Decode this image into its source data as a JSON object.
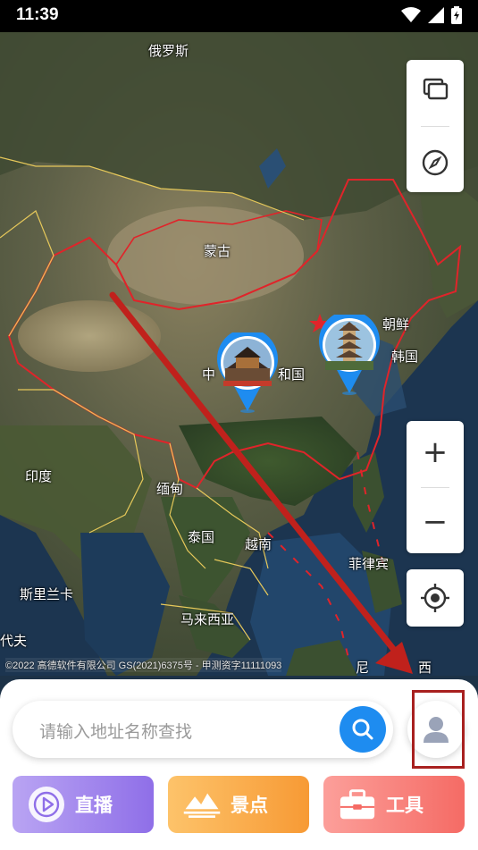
{
  "status_bar": {
    "time": "11:39"
  },
  "map": {
    "labels": [
      {
        "id": "russia",
        "text": "俄罗斯"
      },
      {
        "id": "mongolia",
        "text": "蒙古"
      },
      {
        "id": "nkorea",
        "text": "朝鲜"
      },
      {
        "id": "skorea",
        "text": "韩国"
      },
      {
        "id": "china_a",
        "text": "中"
      },
      {
        "id": "china_b",
        "text": "和国"
      },
      {
        "id": "india",
        "text": "印度"
      },
      {
        "id": "myanmar",
        "text": "缅甸"
      },
      {
        "id": "thailand",
        "text": "泰国"
      },
      {
        "id": "vietnam",
        "text": "越南"
      },
      {
        "id": "philippines",
        "text": "菲律宾"
      },
      {
        "id": "srilanka",
        "text": "斯里兰卡"
      },
      {
        "id": "malaysia",
        "text": "马来西亚"
      },
      {
        "id": "maldives",
        "text": "代夫"
      },
      {
        "id": "indonesia_a",
        "text": "尼"
      },
      {
        "id": "indonesia_b",
        "text": "西"
      }
    ],
    "copyright": "©2022 高德软件有限公司 GS(2021)6375号 - 甲测资字11111093"
  },
  "controls": {
    "layers": "layers-icon",
    "compass": "compass-icon",
    "zoom_in": "+",
    "zoom_out": "−",
    "locate": "locate-icon"
  },
  "search": {
    "placeholder": "请输入地址名称查找"
  },
  "tiles": {
    "live": "直播",
    "spots": "景点",
    "tools": "工具"
  },
  "colors": {
    "accent_blue": "#1e8cf0",
    "border_red": "#e0242a",
    "arrow_red": "#c0211c",
    "live": "#8f6fe8",
    "spots": "#f79a35",
    "tools": "#f56b65"
  }
}
